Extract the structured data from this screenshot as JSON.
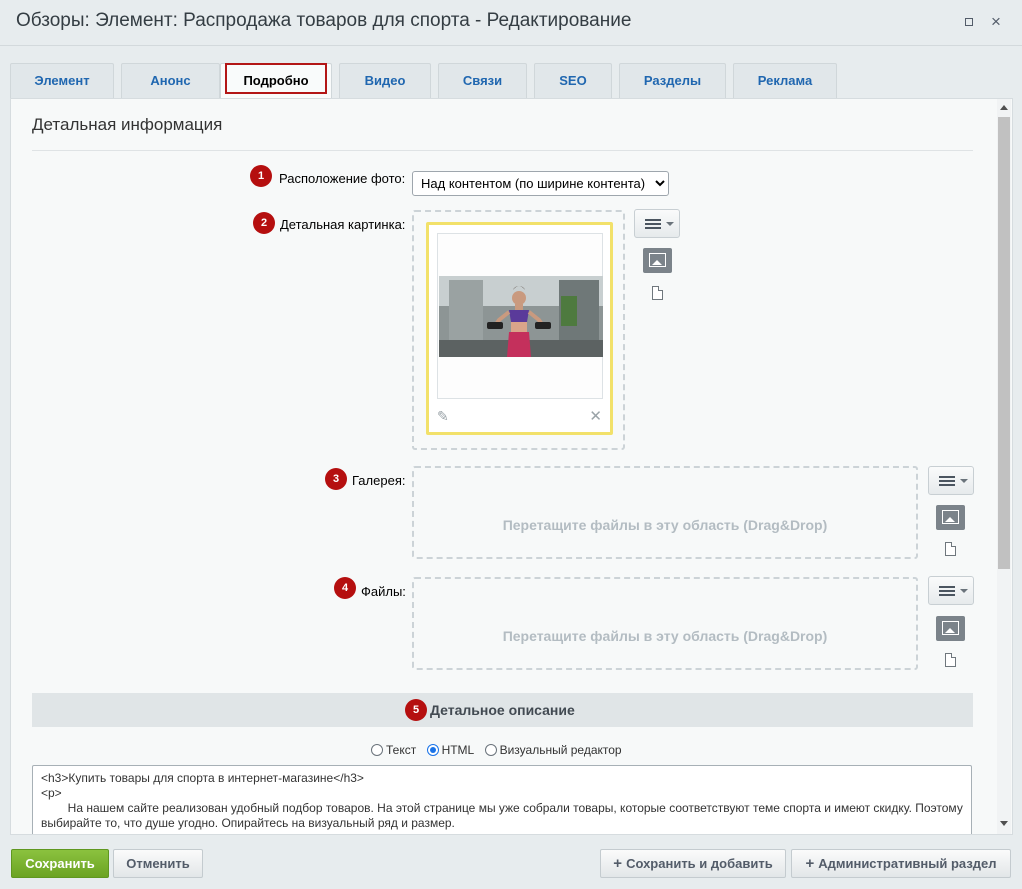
{
  "window": {
    "title": "Обзоры: Элемент: Распродажа товаров для спорта - Редактирование",
    "maximize_icon": "maximize-icon",
    "close_icon": "close-icon",
    "close_glyph": "×"
  },
  "tabs": [
    {
      "label": "Элемент"
    },
    {
      "label": "Анонс"
    },
    {
      "label": "Подробно",
      "active": true
    },
    {
      "label": "Видео"
    },
    {
      "label": "Связи"
    },
    {
      "label": "SEO"
    },
    {
      "label": "Разделы"
    },
    {
      "label": "Реклама"
    }
  ],
  "section": {
    "title": "Детальная информация"
  },
  "badges": [
    "1",
    "2",
    "3",
    "4",
    "5"
  ],
  "fields": {
    "photo_position": {
      "label": "Расположение фото:",
      "selected": "Над контентом (по ширине контента)"
    },
    "detail_picture": {
      "label": "Детальная картинка:"
    },
    "gallery": {
      "label": "Галерея:",
      "drop_text": "Перетащите файлы в эту область (Drag&Drop)"
    },
    "files": {
      "label": "Файлы:",
      "drop_text": "Перетащите файлы в эту область (Drag&Drop)"
    }
  },
  "description": {
    "header": "Детальное описание",
    "modes": [
      "Текст",
      "HTML",
      "Визуальный редактор"
    ],
    "selected_mode": "HTML",
    "code": "<h3>Купить товары для спорта в интернет-магазине</h3>\n<p>\n\tНа нашем сайте реализован удобный подбор товаров. На этой странице мы уже собрали товары, которые соответствуют теме спорта и имеют скидку. Поэтому выбирайте то, что душе угодно. Опирайтесь на визуальный ряд и размер."
  },
  "footer": {
    "save": "Сохранить",
    "cancel": "Отменить",
    "save_add": "Сохранить и добавить",
    "admin": "Административный раздел"
  },
  "colors": {
    "badge": "#b50f0f",
    "save_button": "#7ab52d",
    "active_tab_frame": "#b31616",
    "picture_border": "#f2e16a",
    "tab_link": "#2067b0"
  }
}
